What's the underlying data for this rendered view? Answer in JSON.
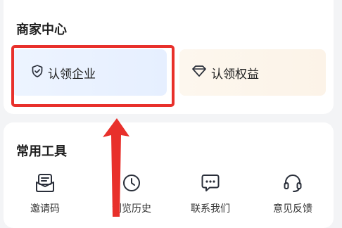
{
  "merchant_center": {
    "title": "商家中心",
    "tiles": [
      {
        "label": "认领企业",
        "icon": "shield-check-icon"
      },
      {
        "label": "认领权益",
        "icon": "diamond-icon"
      }
    ]
  },
  "tools": {
    "title": "常用工具",
    "items": [
      {
        "label": "邀请码",
        "icon": "invite-code-icon"
      },
      {
        "label": "浏览历史",
        "icon": "clock-icon"
      },
      {
        "label": "联系我们",
        "icon": "chat-bubble-icon"
      },
      {
        "label": "意见反馈",
        "icon": "headset-icon"
      }
    ]
  },
  "colors": {
    "highlight": "#e8302b",
    "claim_tile_bg": "#e8f0ff",
    "rights_tile_bg": "#fcf4ea"
  }
}
